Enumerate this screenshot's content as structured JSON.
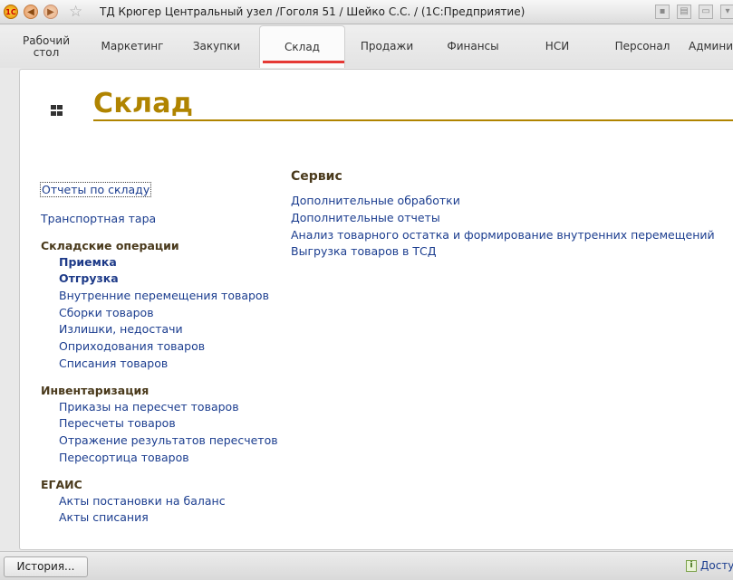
{
  "window": {
    "title": "ТД Крюгер Центральный узел /Гоголя 51 / Шейко С.С. /  (1С:Предприятие)",
    "logo_text": "1С"
  },
  "tabs": [
    {
      "label": "Рабочий стол",
      "active": false
    },
    {
      "label": "Маркетинг",
      "active": false
    },
    {
      "label": "Закупки",
      "active": false
    },
    {
      "label": "Склад",
      "active": true
    },
    {
      "label": "Продажи",
      "active": false
    },
    {
      "label": "Финансы",
      "active": false
    },
    {
      "label": "НСИ",
      "active": false
    },
    {
      "label": "Персонал",
      "active": false
    },
    {
      "label": "Админис",
      "active": false
    }
  ],
  "page": {
    "title": "Склад"
  },
  "left": {
    "reports_link": "Отчеты по складу",
    "transport_link": "Транспортная тара",
    "groups": [
      {
        "title": "Складские операции",
        "items": [
          "Приемка",
          "Отгрузка",
          "Внутренние перемещения товаров",
          "Сборки товаров",
          "Излишки, недостачи",
          "Оприходования товаров",
          "Списания товаров"
        ]
      },
      {
        "title": "Инвентаризация",
        "items": [
          "Приказы на пересчет товаров",
          "Пересчеты товаров",
          "Отражение результатов пересчетов",
          "Пересортица товаров"
        ]
      },
      {
        "title": "ЕГАИС",
        "items": [
          "Акты постановки на баланс",
          "Акты списания"
        ]
      }
    ]
  },
  "service": {
    "title": "Сервис",
    "items": [
      "Дополнительные обработки",
      "Дополнительные отчеты",
      "Анализ товарного остатка и формирование внутренних перемещений",
      "Выгрузка товаров в ТСД"
    ]
  },
  "statusbar": {
    "history_label": "История...",
    "access_label": "Доступ"
  },
  "colors": {
    "accent": "#b08400",
    "link": "#1b3d8f",
    "active_tab_underline": "#e53935"
  }
}
